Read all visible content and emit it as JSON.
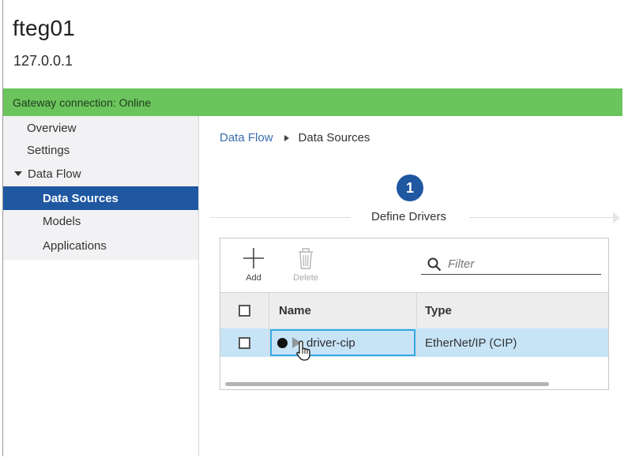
{
  "device": {
    "name": "fteg01",
    "ip": "127.0.0.1"
  },
  "status": {
    "text": "Gateway connection: Online",
    "color": "#6cc45c"
  },
  "sidebar": {
    "items": [
      {
        "label": "Overview",
        "level": 0,
        "selected": false
      },
      {
        "label": "Settings",
        "level": 0,
        "selected": false
      },
      {
        "label": "Data Flow",
        "level": 0,
        "expanded": true,
        "selected": false
      },
      {
        "label": "Data Sources",
        "level": 1,
        "selected": true
      },
      {
        "label": "Models",
        "level": 1,
        "selected": false
      },
      {
        "label": "Applications",
        "level": 1,
        "selected": false
      }
    ]
  },
  "breadcrumb": {
    "parent": "Data Flow",
    "current": "Data Sources"
  },
  "wizard": {
    "step_number": "1",
    "step_label": "Define Drivers"
  },
  "toolbar": {
    "add_label": "Add",
    "delete_label": "Delete",
    "filter_placeholder": "Filter"
  },
  "table": {
    "columns": [
      "Name",
      "Type"
    ],
    "rows": [
      {
        "name": "driver-cip",
        "type": "EtherNet/IP (CIP)",
        "selected": true
      }
    ]
  },
  "colors": {
    "accent": "#1f57a1",
    "selection": "#c7e4f7",
    "focus": "#38a7e0"
  },
  "icons": [
    "add-icon",
    "trash-icon",
    "search-icon",
    "status-dot-icon",
    "play-icon",
    "hand-cursor-icon",
    "expand-caret-icon",
    "breadcrumb-separator-icon"
  ]
}
